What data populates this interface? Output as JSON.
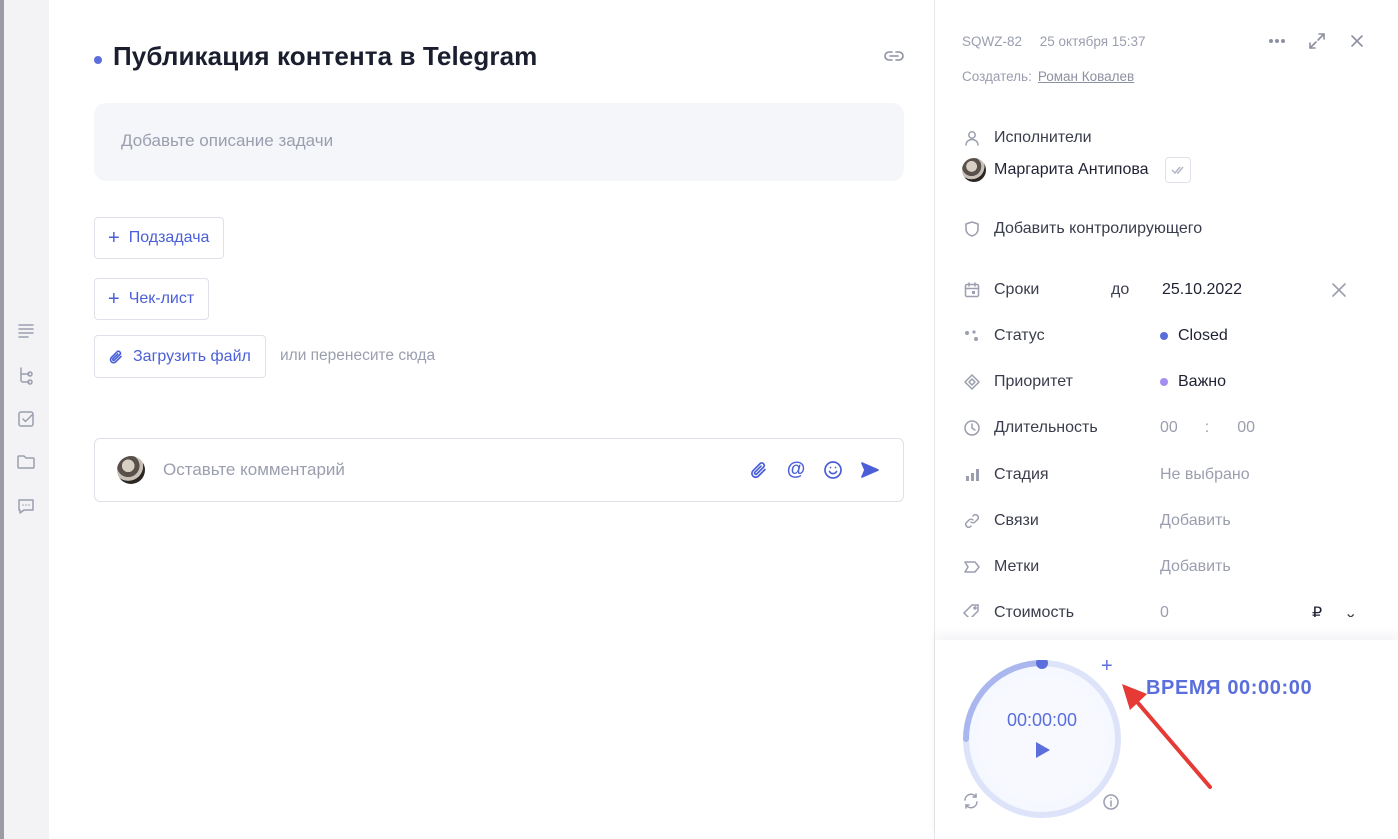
{
  "task": {
    "title": "Публикация контента в Telegram",
    "description_placeholder": "Добавьте описание задачи",
    "subtask_label": "Подзадача",
    "checklist_label": "Чек-лист",
    "upload_label": "Загрузить файл",
    "drop_hint": "или перенесите сюда",
    "comment_placeholder": "Оставьте комментарий"
  },
  "details": {
    "task_id": "SQWZ-82",
    "created_at": "25 октября 15:37",
    "creator_label": "Создатель:",
    "creator_name": "Роман Ковалев",
    "assignees_label": "Исполнители",
    "assignee_name": "Маргарита Антипова",
    "add_controller": "Добавить контролирующего",
    "deadline_label": "Сроки",
    "deadline_prefix": "до",
    "deadline_value": "25.10.2022",
    "status_label": "Статус",
    "status_value": "Closed",
    "priority_label": "Приоритет",
    "priority_value": "Важно",
    "duration_label": "Длительность",
    "duration_hours": "00",
    "duration_sep": ":",
    "duration_minutes": "00",
    "stage_label": "Стадия",
    "stage_value": "Не выбрано",
    "links_label": "Связи",
    "links_value": "Добавить",
    "tags_label": "Метки",
    "tags_value": "Добавить",
    "cost_label": "Стоимость",
    "cost_value": "0",
    "cost_currency": "₽"
  },
  "timer": {
    "time": "00:00:00",
    "plus": "+",
    "label": "ВРЕМЯ 00:00:00"
  },
  "colors": {
    "accent": "#5b6fdc",
    "status_dot": "#5b6fdc",
    "priority_dot": "#a48ef0",
    "annotation_arrow": "#e53a35"
  }
}
